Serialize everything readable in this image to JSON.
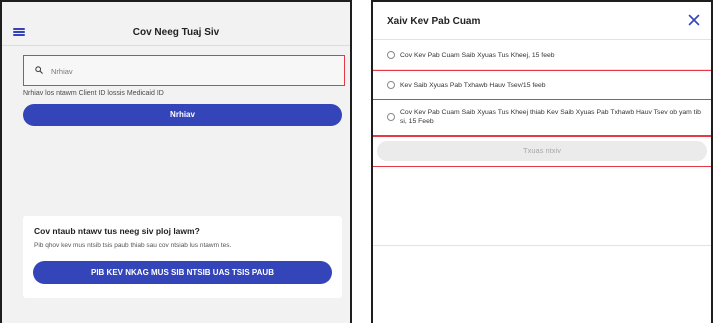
{
  "left": {
    "title": "Cov Neeg Tuaj Siv",
    "search": {
      "placeholder": "Nrhiav",
      "value": ""
    },
    "helper_text": "Nrhiav los ntawm Client ID lossis Medicaid ID",
    "search_button_label": "Nrhiav",
    "help_card": {
      "title": "Cov ntaub ntawv tus neeg siv ploj lawm?",
      "subtitle": "Pib qhov kev mus ntsib tsis paub thiab sau cov ntsiab lus ntawm tes.",
      "button_label": "PIB KEV NKAG MUS SIB NTSIB UAS TSIS PAUB"
    },
    "accent_color": "#3444b9"
  },
  "right": {
    "title": "Xaiv Kev Pab Cuam",
    "close_icon": "close-icon",
    "options": [
      {
        "label": "Cov Kev Pab Cuam Saib Xyuas Tus Kheej, 15 feeb"
      },
      {
        "label": "Kev Saib Xyuas Pab Txhawb Hauv Tsev/15 feeb"
      },
      {
        "label": "Cov Kev Pab Cuam Saib Xyuas Tus Kheej thiab Kev Saib Xyuas Pab Txhawb Hauv Tsev ob yam tib si, 15 Feeb"
      }
    ],
    "submit_label": "Txuas ntxiv",
    "highlight_color": "#e53945"
  }
}
